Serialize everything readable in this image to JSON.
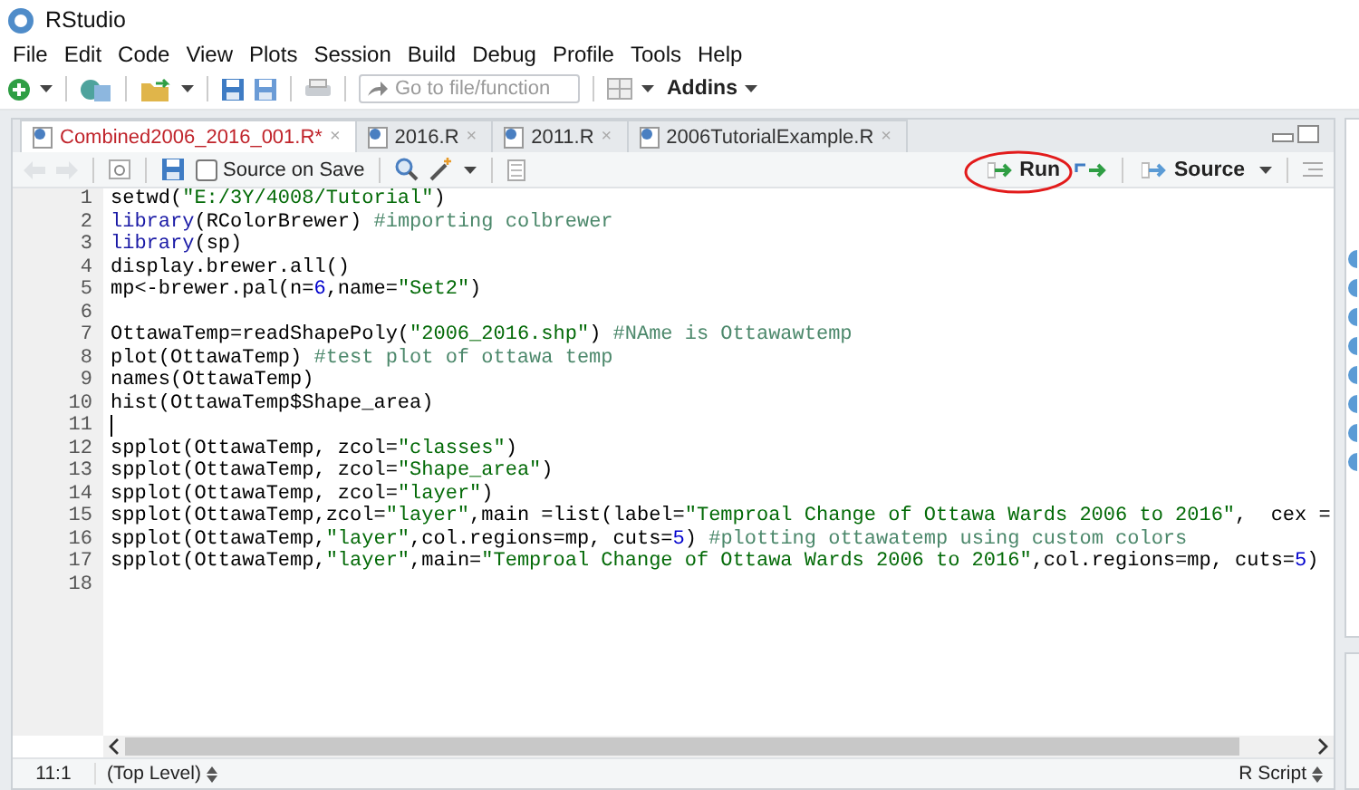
{
  "window": {
    "title": "RStudio"
  },
  "menu": [
    "File",
    "Edit",
    "Code",
    "View",
    "Plots",
    "Session",
    "Build",
    "Debug",
    "Profile",
    "Tools",
    "Help"
  ],
  "toolbar": {
    "goto_placeholder": "Go to file/function",
    "addins": "Addins"
  },
  "tabs": [
    {
      "label": "Combined2006_2016_001.R*",
      "close": "×",
      "selected": true
    },
    {
      "label": "2016.R",
      "close": "×",
      "selected": false
    },
    {
      "label": "2011.R",
      "close": "×",
      "selected": false
    },
    {
      "label": "2006TutorialExample.R",
      "close": "×",
      "selected": false
    }
  ],
  "editor_toolbar": {
    "source_on_save": {
      "label": "Source on Save",
      "checked": false
    },
    "run": "Run",
    "source": "Source"
  },
  "lines": [
    {
      "number": "1",
      "cursor": false,
      "tokens": [
        {
          "kind": "plain",
          "t": "setwd("
        },
        {
          "kind": "str",
          "t": "\"E:/3Y/4008/Tutorial\""
        },
        {
          "kind": "plain",
          "t": ")"
        }
      ]
    },
    {
      "number": "2",
      "cursor": false,
      "tokens": [
        {
          "kind": "kw",
          "t": "library"
        },
        {
          "kind": "plain",
          "t": "(RColorBrewer) "
        },
        {
          "kind": "com",
          "t": "#importing colbrewer"
        }
      ]
    },
    {
      "number": "3",
      "cursor": false,
      "tokens": [
        {
          "kind": "kw",
          "t": "library"
        },
        {
          "kind": "plain",
          "t": "(sp)"
        }
      ]
    },
    {
      "number": "4",
      "cursor": false,
      "tokens": [
        {
          "kind": "plain",
          "t": "display.brewer.all()"
        }
      ]
    },
    {
      "number": "5",
      "cursor": false,
      "tokens": [
        {
          "kind": "plain",
          "t": "mp<-brewer.pal(n="
        },
        {
          "kind": "num",
          "t": "6"
        },
        {
          "kind": "plain",
          "t": ",name="
        },
        {
          "kind": "str",
          "t": "\"Set2\""
        },
        {
          "kind": "plain",
          "t": ")"
        }
      ]
    },
    {
      "number": "6",
      "cursor": false
    },
    {
      "number": "7",
      "cursor": false,
      "tokens": [
        {
          "kind": "plain",
          "t": "OttawaTemp=readShapePoly("
        },
        {
          "kind": "str",
          "t": "\"2006_2016.shp\""
        },
        {
          "kind": "plain",
          "t": ") "
        },
        {
          "kind": "com",
          "t": "#NAme is Ottawawtemp"
        }
      ]
    },
    {
      "number": "8",
      "cursor": false,
      "tokens": [
        {
          "kind": "plain",
          "t": "plot(OttawaTemp) "
        },
        {
          "kind": "com",
          "t": "#test plot of ottawa temp"
        }
      ]
    },
    {
      "number": "9",
      "cursor": false,
      "tokens": [
        {
          "kind": "plain",
          "t": "names(OttawaTemp)"
        }
      ]
    },
    {
      "number": "10",
      "cursor": false,
      "tokens": [
        {
          "kind": "plain",
          "t": "hist(OttawaTemp$Shape_area)"
        }
      ]
    },
    {
      "number": "11",
      "cursor": true
    },
    {
      "number": "12",
      "cursor": false,
      "tokens": [
        {
          "kind": "plain",
          "t": "spplot(OttawaTemp, zcol="
        },
        {
          "kind": "str",
          "t": "\"classes\""
        },
        {
          "kind": "plain",
          "t": ")"
        }
      ]
    },
    {
      "number": "13",
      "cursor": false,
      "tokens": [
        {
          "kind": "plain",
          "t": "spplot(OttawaTemp, zcol="
        },
        {
          "kind": "str",
          "t": "\"Shape_area\""
        },
        {
          "kind": "plain",
          "t": ")"
        }
      ]
    },
    {
      "number": "14",
      "cursor": false,
      "tokens": [
        {
          "kind": "plain",
          "t": "spplot(OttawaTemp, zcol="
        },
        {
          "kind": "str",
          "t": "\"layer\""
        },
        {
          "kind": "plain",
          "t": ")"
        }
      ]
    },
    {
      "number": "15",
      "cursor": false,
      "tokens": [
        {
          "kind": "plain",
          "t": "spplot(OttawaTemp,zcol="
        },
        {
          "kind": "str",
          "t": "\"layer\""
        },
        {
          "kind": "plain",
          "t": ",main =list(label="
        },
        {
          "kind": "str",
          "t": "\"Temproal Change of Ottawa Wards 2006 to 2016\""
        },
        {
          "kind": "plain",
          "t": ",  cex ="
        }
      ]
    },
    {
      "number": "16",
      "cursor": false,
      "tokens": [
        {
          "kind": "plain",
          "t": "spplot(OttawaTemp,"
        },
        {
          "kind": "str",
          "t": "\"layer\""
        },
        {
          "kind": "plain",
          "t": ",col.regions=mp, cuts="
        },
        {
          "kind": "num",
          "t": "5"
        },
        {
          "kind": "plain",
          "t": ") "
        },
        {
          "kind": "com",
          "t": "#plotting ottawatemp using custom colors"
        }
      ]
    },
    {
      "number": "17",
      "cursor": false,
      "tokens": [
        {
          "kind": "plain",
          "t": "spplot(OttawaTemp,"
        },
        {
          "kind": "str",
          "t": "\"layer\""
        },
        {
          "kind": "plain",
          "t": ",main="
        },
        {
          "kind": "str",
          "t": "\"Temproal Change of Ottawa Wards 2006 to 2016\""
        },
        {
          "kind": "plain",
          "t": ",col.regions=mp, cuts="
        },
        {
          "kind": "num",
          "t": "5"
        },
        {
          "kind": "plain",
          "t": ")"
        }
      ]
    },
    {
      "number": "18",
      "cursor": false
    }
  ],
  "status_bar": {
    "position": "11:1",
    "scope": "(Top Level)",
    "file_type": "R Script"
  }
}
